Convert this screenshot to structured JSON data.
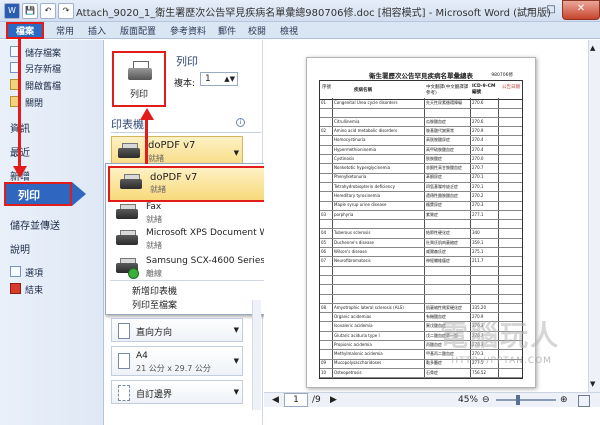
{
  "window": {
    "title": "Attach_9020_1_衛生署歷次公告罕見疾病名單彙總980706修.doc [相容模式] - Microsoft Word (試用版)",
    "quick_access": [
      "W",
      "💾",
      "↶",
      "↷"
    ],
    "controls": [
      "–",
      "□",
      "✕"
    ]
  },
  "ribbon": {
    "file_tab": "檔案",
    "tabs": [
      "常用",
      "插入",
      "版面配置",
      "參考資料",
      "郵件",
      "校閱",
      "檢視"
    ]
  },
  "nav": {
    "small_items": [
      {
        "label": "儲存檔案",
        "icon": "save-icon"
      },
      {
        "label": "另存新檔",
        "icon": "save-as-icon"
      },
      {
        "label": "開啟舊檔",
        "icon": "open-folder-icon"
      },
      {
        "label": "關閉",
        "icon": "close-doc-icon"
      }
    ],
    "big_items": [
      "資訊",
      "最近",
      "新增",
      "列印",
      "儲存並傳送",
      "說明"
    ],
    "selected": "列印",
    "bottom_items": [
      {
        "label": "選項",
        "icon": "options-icon"
      },
      {
        "label": "結束",
        "icon": "exit-icon"
      }
    ]
  },
  "print_panel": {
    "heading": "列印",
    "button_label": "列印",
    "copies_label": "複本:",
    "copies_value": "1",
    "printer_section": "印表機",
    "selected_printer": {
      "name": "doPDF v7",
      "status": "就緒"
    },
    "printers": [
      {
        "name": "doPDF v7",
        "status": "就緒",
        "selected": true
      },
      {
        "name": "Fax",
        "status": "就緒"
      },
      {
        "name": "Microsoft XPS Document Writer",
        "status": "就緒"
      },
      {
        "name": "Samsung SCX-4600 Series",
        "status": "離線"
      }
    ],
    "dropdown_links": [
      "新增印表機",
      "列印至檔案"
    ],
    "settings": [
      {
        "label": "直向方向",
        "icon": "portrait-icon"
      },
      {
        "label": "A4",
        "sub": "21 公分 x 29.7 公分",
        "icon": "paper-size-icon"
      },
      {
        "label": "自訂邊界",
        "icon": "margins-icon"
      }
    ]
  },
  "preview": {
    "doc_title": "衛生署歷次公告罕見疾病名單彙總表",
    "doc_code": "980706修",
    "header_cols": [
      "序號",
      "疾病名稱",
      "中文翻譯(中文翻譯譯參考)",
      "ICD-9-CM 編號",
      "公告日期"
    ],
    "rows": [
      {
        "no": "01",
        "en": "Congenital Urea cycle disorders",
        "zh": "先天性尿素循環障礙",
        "code": "270.6"
      },
      {
        "no": "",
        "en": "",
        "zh": "",
        "code": ""
      },
      {
        "no": "",
        "en": "Citrullinemia",
        "zh": "瓜胺酸血症",
        "code": "270.6"
      },
      {
        "no": "02",
        "en": "Amino acid metabolic disorders",
        "zh": "胺基酸代謝異常",
        "code": "270.9"
      },
      {
        "no": "",
        "en": "Homocystinuria",
        "zh": "高胱胺酸尿症",
        "code": "270.4"
      },
      {
        "no": "",
        "en": "Hypermethioninemia",
        "zh": "高甲硫胺酸血症",
        "code": "270.4"
      },
      {
        "no": "",
        "en": "Cystinosis",
        "zh": "胱胺酸症",
        "code": "270.0"
      },
      {
        "no": "",
        "en": "Nonketotic hyperglycinemia",
        "zh": "非酮性高甘胺酸血症",
        "code": "270.7"
      },
      {
        "no": "",
        "en": "Phenylketonuria",
        "zh": "苯酮尿症",
        "code": "270.1"
      },
      {
        "no": "",
        "en": "Tetrahydrobiopterin deficiency",
        "zh": "四氫基喋呤缺乏症",
        "code": "270.1"
      },
      {
        "no": "",
        "en": "Hereditary tyrosinemia",
        "zh": "遺傳性酪胺酸血症",
        "code": "270.2"
      },
      {
        "no": "",
        "en": "Maple syrup urine disease",
        "zh": "楓漿尿症",
        "code": "270.3"
      },
      {
        "no": "03",
        "en": "porphyria",
        "zh": "紫質症",
        "code": "277.1"
      },
      {
        "no": "",
        "en": "",
        "zh": "",
        "code": ""
      },
      {
        "no": "04",
        "en": "Tuberous sclerosis",
        "zh": "結節性硬化症",
        "code": "340"
      },
      {
        "no": "05",
        "en": "Duchenne's disease",
        "zh": "杜興氏肌肉萎縮症",
        "code": "359.1"
      },
      {
        "no": "06",
        "en": "Wilson's disease",
        "zh": "威爾森氏症",
        "code": "275.1"
      },
      {
        "no": "07",
        "en": "Neurofibromatosis",
        "zh": "神經纖維瘤症",
        "code": "211.7"
      },
      {
        "no": "",
        "en": "",
        "zh": "",
        "code": ""
      },
      {
        "no": "",
        "en": "",
        "zh": "",
        "code": ""
      },
      {
        "no": "",
        "en": "",
        "zh": "",
        "code": ""
      },
      {
        "no": "",
        "en": "",
        "zh": "",
        "code": ""
      },
      {
        "no": "08",
        "en": "Amyotrophic lateral sclerosis (ALS)",
        "zh": "肌萎縮性側索硬化症",
        "code": "335.20"
      },
      {
        "no": "",
        "en": "Organic acidemias",
        "zh": "有機酸血症",
        "code": "270.9"
      },
      {
        "no": "",
        "en": "Isovaleric acidemia",
        "zh": "異戊酸血症",
        "code": "270.3"
      },
      {
        "no": "",
        "en": "Glutaric aciduria type I",
        "zh": "戊二酸血症第一型",
        "code": "270.7"
      },
      {
        "no": "",
        "en": "Propionic acidemia",
        "zh": "丙酸血症",
        "code": "270.3"
      },
      {
        "no": "",
        "en": "Methylmalonic acidemia",
        "zh": "甲基丙二酸血症",
        "code": "270.3"
      },
      {
        "no": "09",
        "en": "Mucopolysaccharidoses",
        "zh": "黏多醣症",
        "code": "277.5"
      },
      {
        "no": "10",
        "en": "Osteopetrosis",
        "zh": "石骨症",
        "code": "756.52"
      }
    ]
  },
  "status": {
    "page_current": "1",
    "page_total": "/9",
    "zoom": "45%"
  },
  "watermark": {
    "text": "電腦玩人",
    "url": "HTTP://PPTAN.COM"
  }
}
